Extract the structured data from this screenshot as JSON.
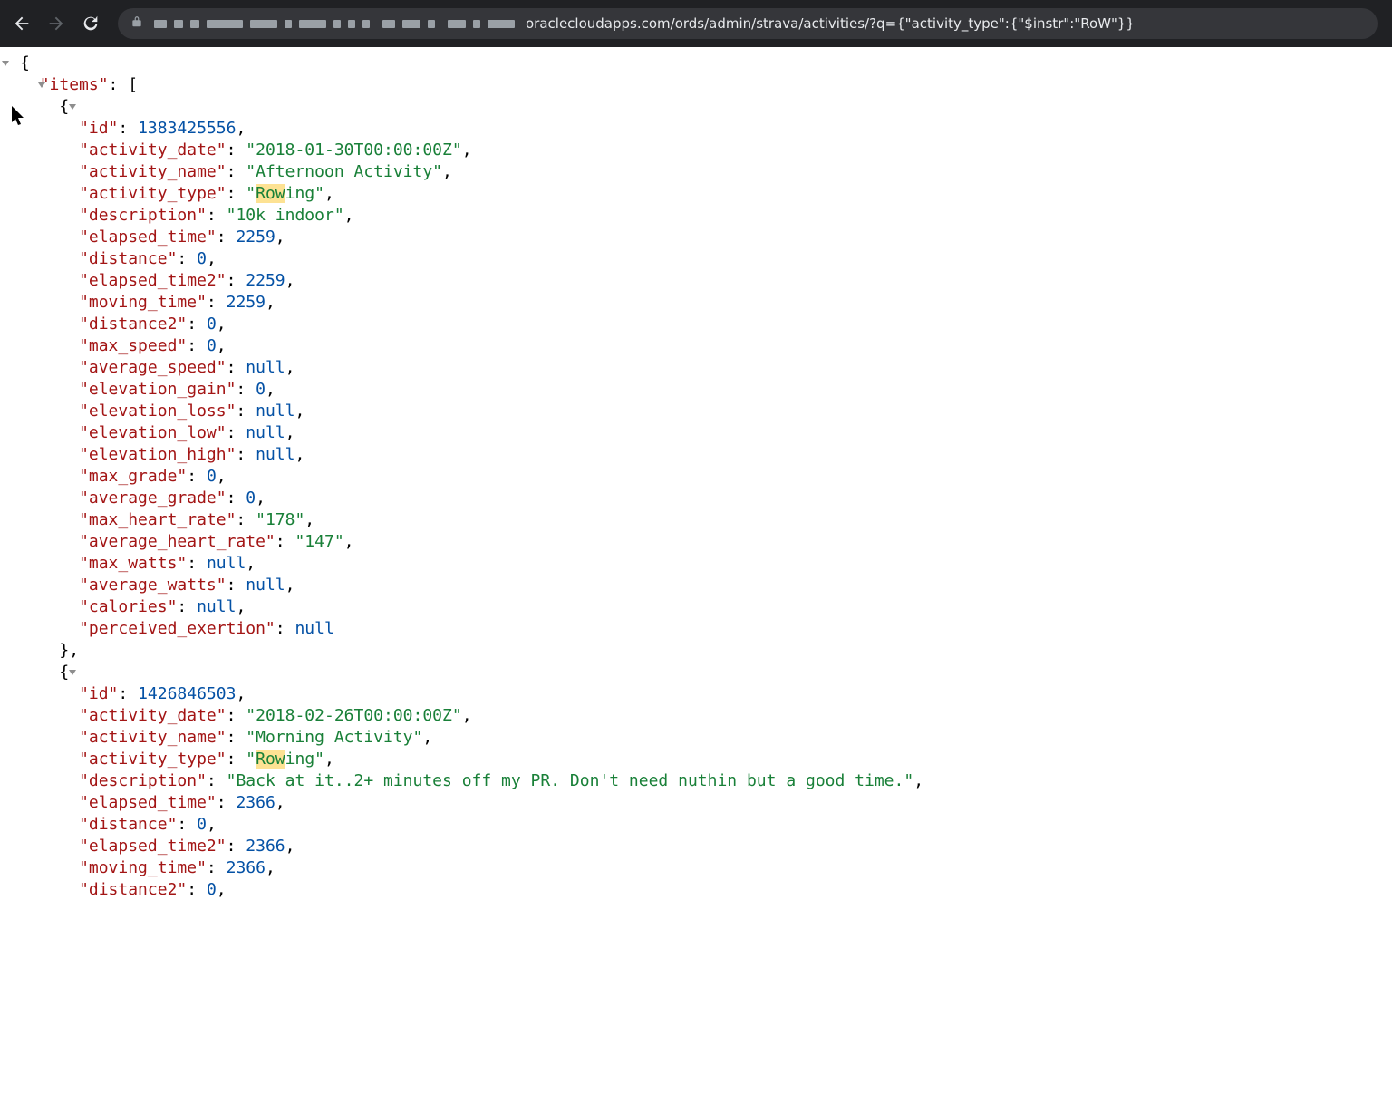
{
  "address_url": "oraclecloudapps.com/ords/admin/strava/activities/?q={\"activity_type\":{\"$instr\":\"RoW\"}}",
  "highlight": "Row",
  "json_root_key": "items",
  "json_items": [
    {
      "id": 1383425556,
      "activity_date": "2018-01-30T00:00:00Z",
      "activity_name": "Afternoon Activity",
      "activity_type": "Rowing",
      "description": "10k indoor",
      "elapsed_time": 2259,
      "distance": 0,
      "elapsed_time2": 2259,
      "moving_time": 2259,
      "distance2": 0,
      "max_speed": 0,
      "average_speed": null,
      "elevation_gain": 0,
      "elevation_loss": null,
      "elevation_low": null,
      "elevation_high": null,
      "max_grade": 0,
      "average_grade": 0,
      "max_heart_rate": "178",
      "average_heart_rate": "147",
      "max_watts": null,
      "average_watts": null,
      "calories": null,
      "perceived_exertion": null
    },
    {
      "id": 1426846503,
      "activity_date": "2018-02-26T00:00:00Z",
      "activity_name": "Morning Activity",
      "activity_type": "Rowing",
      "description": "Back at it..2+ minutes off my PR. Don't need nuthin but a good time.",
      "elapsed_time": 2366,
      "distance": 0,
      "elapsed_time2": 2366,
      "moving_time": 2366,
      "distance2": 0
    }
  ],
  "item2_visible_keys": [
    "id",
    "activity_date",
    "activity_name",
    "activity_type",
    "description",
    "elapsed_time",
    "distance",
    "elapsed_time2",
    "moving_time",
    "distance2"
  ]
}
